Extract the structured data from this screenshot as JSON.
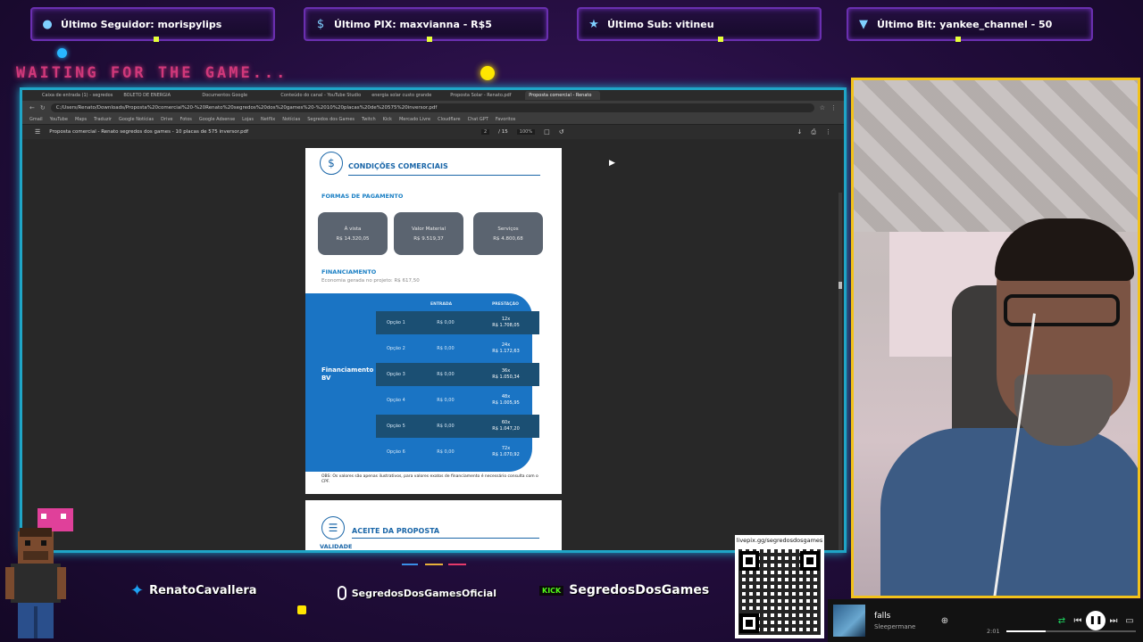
{
  "alerts": [
    {
      "icon": "user-icon",
      "text": "Último Seguidor: morispylips"
    },
    {
      "icon": "dollar-icon",
      "text": "Último PIX: maxvianna - R$5"
    },
    {
      "icon": "star-icon",
      "text": "Último Sub: vitineu"
    },
    {
      "icon": "diamond-icon",
      "text": "Último Bit: yankee_channel - 50"
    }
  ],
  "overlay": {
    "waiting": "WAITING FOR THE GAME..."
  },
  "browser": {
    "tabs": [
      "Caixa de entrada (1) - segredos",
      "BOLETO DE ENERGIA",
      "Documentos Google",
      "Conteúdo do canal - YouTube Studio",
      "energia solar custo grande",
      "Proposta Solar - Renato.pdf",
      "Proposta comercial - Renato"
    ],
    "url": "C:/Users/Renato/Downloads/Proposta%20comercial%20-%20Renato%20segredos%20dos%20games%20-%2010%20placas%20de%20575%20inversor.pdf",
    "bookmarks": [
      "Gmail",
      "YouTube",
      "Maps",
      "Traduzir",
      "Google Notícias",
      "Drive",
      "Fotos",
      "Google Adsense",
      "Lojas",
      "Netflix",
      "Notícias",
      "Segredos dos Games",
      "Twitch",
      "Kick",
      "Mercado Livre",
      "Cloudflare",
      "Chat GPT",
      "Favoritos"
    ],
    "pdf_title": "Proposta comercial - Renato segredos dos games - 10 placas de 575 inversor.pdf",
    "page_num": "2",
    "page_total": "/ 15",
    "zoom": "100%"
  },
  "proposal": {
    "section_title": "CONDIÇÕES COMERCIAIS",
    "payment_heading": "FORMAS DE PAGAMENTO",
    "cards": [
      {
        "label": "À vista",
        "value": "R$ 14.320,05"
      },
      {
        "label": "Valor Material",
        "value": "R$ 9.519,37"
      },
      {
        "label": "Serviços",
        "value": "R$ 4.800,68"
      }
    ],
    "financing_heading": "FINANCIAMENTO",
    "financing_note": "Economia gerada no projeto: R$ 617,50",
    "bv_label_1": "Financiamento",
    "bv_label_2": "BV",
    "col_entrada": "ENTRADA",
    "col_prestacao": "PRESTAÇÃO",
    "options": [
      {
        "name": "Opção 1",
        "entrada": "R$ 0,00",
        "prazo": "12x",
        "parcela": "R$ 1.708,05"
      },
      {
        "name": "Opção 2",
        "entrada": "R$ 0,00",
        "prazo": "24x",
        "parcela": "R$ 1.172,63"
      },
      {
        "name": "Opção 3",
        "entrada": "R$ 0,00",
        "prazo": "36x",
        "parcela": "R$ 1.050,34"
      },
      {
        "name": "Opção 4",
        "entrada": "R$ 0,00",
        "prazo": "48x",
        "parcela": "R$ 1.005,95"
      },
      {
        "name": "Opção 5",
        "entrada": "R$ 0,00",
        "prazo": "60x",
        "parcela": "R$ 1.047,20"
      },
      {
        "name": "Opção 6",
        "entrada": "R$ 0,00",
        "prazo": "72x",
        "parcela": "R$ 1.070,92"
      }
    ],
    "obs": "OBS: Os valores são apenas ilustrativos, para valores exatos de financiamento é necessário consulta com o CPF.",
    "next_section_title": "ACEITE DA PROPOSTA",
    "next_sub": "VALIDADE"
  },
  "socials": {
    "twitter": "RenatoCavallera",
    "instagram": "SegredosDosGamesOficial",
    "kick_badge": "KICK",
    "kick": "SegredosDosGames"
  },
  "qr": {
    "caption": "livepix.gg/segredosdosgames"
  },
  "player": {
    "title": "falls",
    "artist": "Sleepermane",
    "time": "2:01",
    "progress": 0.3
  },
  "colors": {
    "frame": "#1fa5c7",
    "cam_border": "#f2c21a",
    "pdf_blue": "#1a74c4",
    "accent_pink": "#d0387a"
  }
}
